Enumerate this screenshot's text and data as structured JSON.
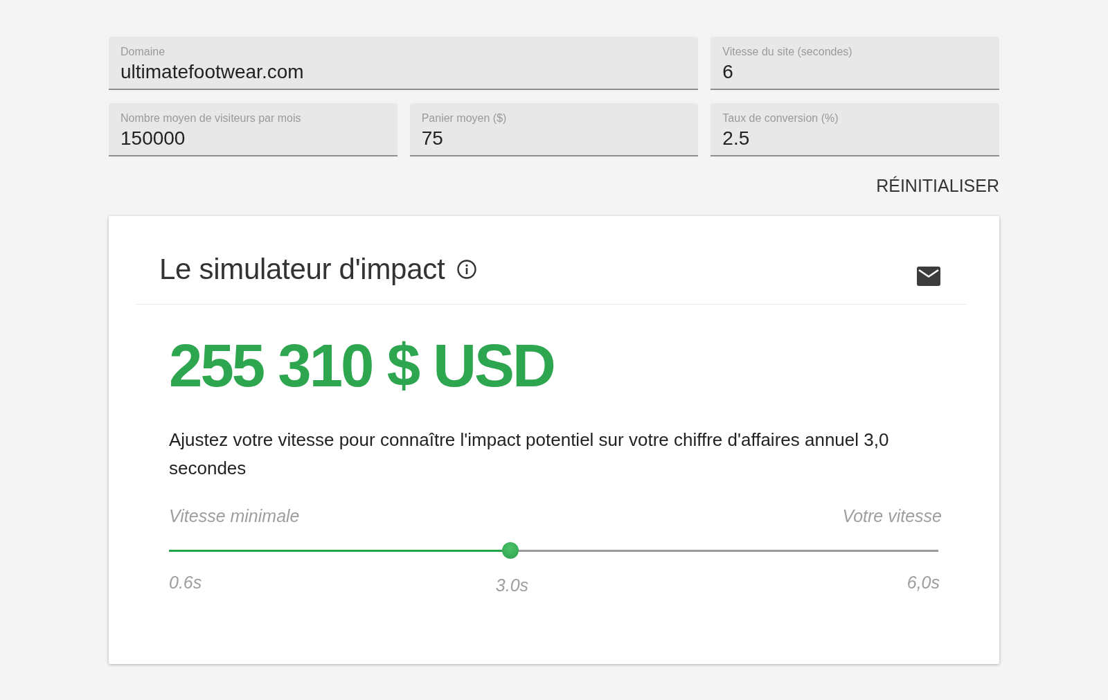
{
  "form": {
    "fields": [
      {
        "label": "Domaine",
        "value": "ultimatefootwear.com"
      },
      {
        "label": "Vitesse du site (secondes)",
        "value": "6"
      },
      {
        "label": "Nombre moyen de visiteurs par mois",
        "value": "150000"
      },
      {
        "label": "Panier moyen ($)",
        "value": "75"
      },
      {
        "label": "Taux de conversion (%)",
        "value": "2.5"
      }
    ],
    "reset_button": "RÉINITIALISER"
  },
  "simulator": {
    "title": "Le simulateur d'impact",
    "amount": "255 310 $ USD",
    "description": "Ajustez votre vitesse pour connaître l'impact potentiel sur votre chiffre d'affaires annuel 3,0 secondes",
    "slider": {
      "min_label": "Vitesse minimale",
      "max_label": "Votre vitesse",
      "level": 0.444,
      "start_tick": "0.6s",
      "current_value": "3.0s",
      "end_tick": "6,0s"
    }
  }
}
